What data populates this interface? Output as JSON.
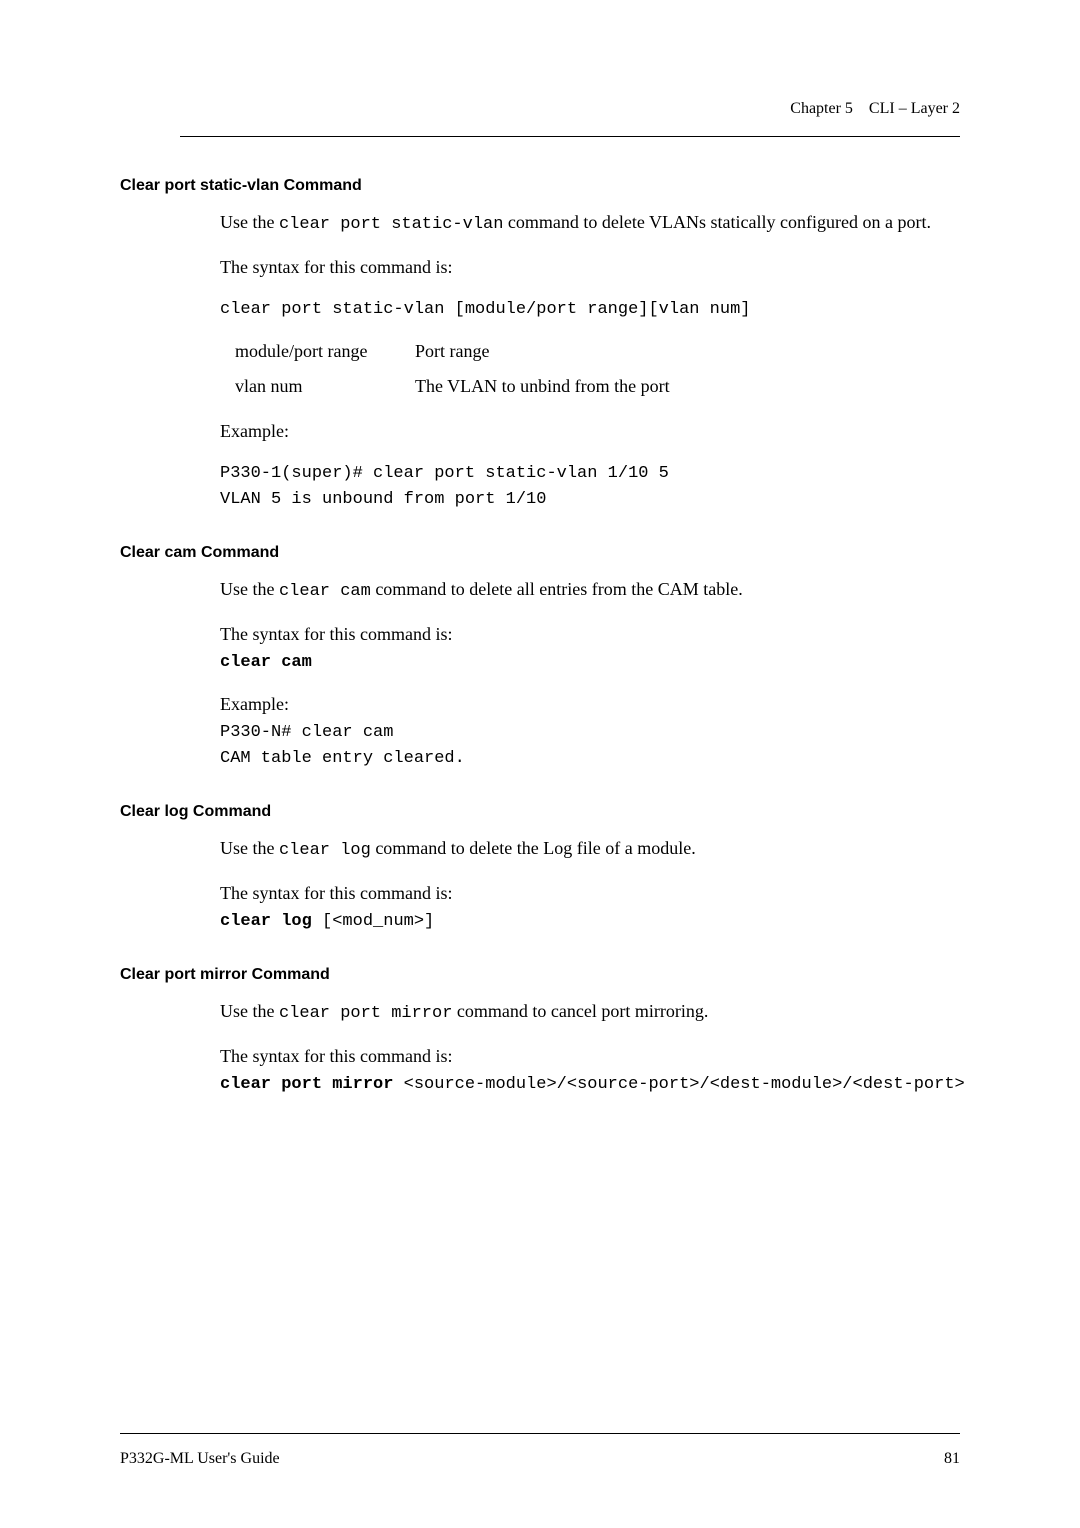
{
  "header": {
    "chapter": "Chapter 5",
    "title": "CLI – Layer 2"
  },
  "sections": {
    "clear_port_static_vlan": {
      "heading": "Clear port static-vlan Command",
      "intro_parts": {
        "pre": "Use the ",
        "code": "clear port static-vlan",
        "post": " command to delete VLANs statically configured on a port."
      },
      "syntax_label": "The syntax for this command is:",
      "syntax_code": "clear port static-vlan [module/port range][vlan num]",
      "params": [
        {
          "name": "module/port range",
          "desc": "Port range"
        },
        {
          "name": "vlan num",
          "desc": "The VLAN to unbind from the port"
        }
      ],
      "example_label": "Example:",
      "example_code": "P330-1(super)# clear port static-vlan 1/10 5\nVLAN 5 is unbound from port 1/10"
    },
    "clear_cam": {
      "heading": "Clear cam Command",
      "intro_parts": {
        "pre": "Use the  ",
        "code": "clear cam",
        "post": "  command to delete all entries from the CAM table."
      },
      "syntax_label": "The syntax for this command is:",
      "syntax_code_bold": "clear cam",
      "example_label": "Example:",
      "example_code": "P330-N# clear cam\nCAM table entry cleared."
    },
    "clear_log": {
      "heading": "Clear log Command",
      "intro_parts": {
        "pre": "Use the  ",
        "code": "clear log",
        "post": "  command to delete the Log file of a module."
      },
      "syntax_label": "The syntax for this command is:",
      "syntax_bold": "clear log",
      "syntax_rest": " [<mod_num>]"
    },
    "clear_port_mirror": {
      "heading": "Clear port mirror Command",
      "intro_parts": {
        "pre": "Use the  ",
        "code": "clear port mirror",
        "post": "  command to cancel port mirroring."
      },
      "syntax_label": "The syntax for this command is:",
      "syntax_bold": "clear port mirror",
      "syntax_rest": " <source-module>/<source-port>/<dest-module>/<dest-port>"
    }
  },
  "footer": {
    "guide": "P332G-ML User's Guide",
    "page": "81"
  }
}
